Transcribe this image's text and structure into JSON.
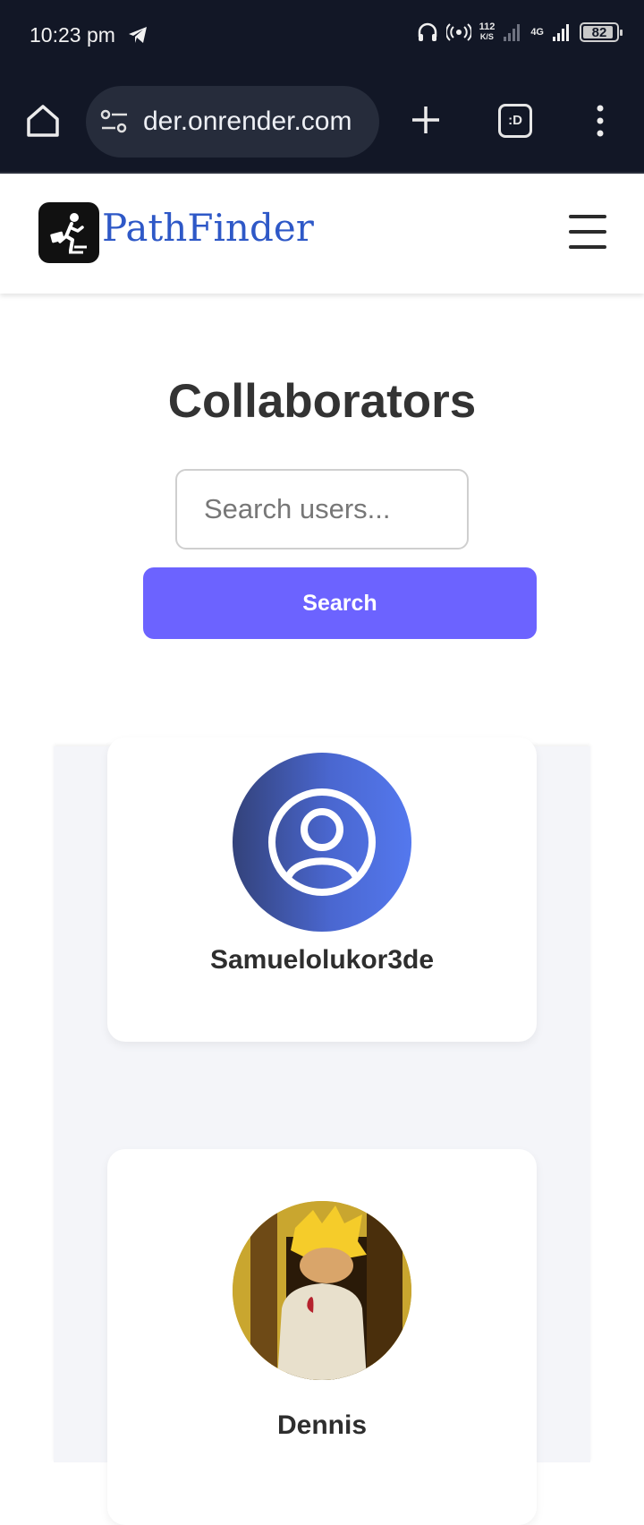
{
  "status_bar": {
    "time": "10:23 pm",
    "net_speed_value": "112",
    "net_speed_unit": "K/S",
    "network_type": "4G",
    "battery_level": "82"
  },
  "browser": {
    "url": "der.onrender.com",
    "tabs_label": ":D"
  },
  "site": {
    "brand": "PathFinder"
  },
  "page": {
    "title": "Collaborators",
    "search_placeholder": "Search users...",
    "search_button": "Search"
  },
  "users": [
    {
      "name": "Samuelolukor3de",
      "avatar": "default-user-icon"
    },
    {
      "name": "Dennis",
      "avatar": "anime-character-photo"
    }
  ],
  "colors": {
    "accent": "#6c63ff",
    "brand": "#2e58c7",
    "status_bar_bg": "#121726"
  }
}
